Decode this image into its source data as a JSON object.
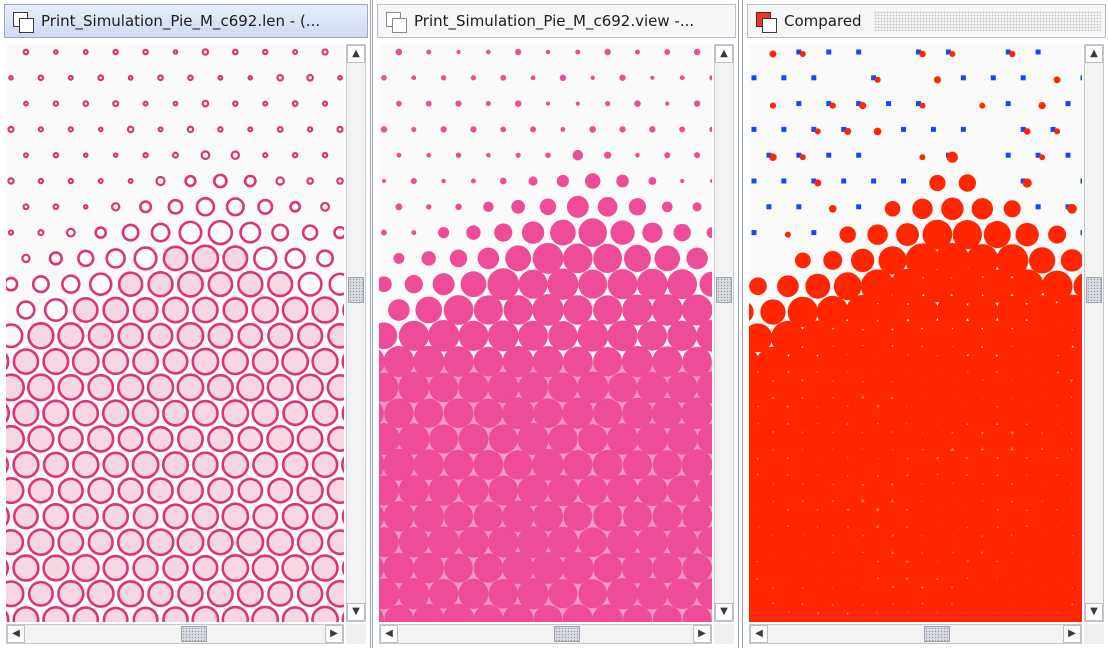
{
  "panes": [
    {
      "title": "Print_Simulation_Pie_M_c692.len - (...",
      "icon": "window-icon",
      "view": "circle-outline-halftone"
    },
    {
      "title": "Print_Simulation_Pie_M_c692.view -...",
      "icon": "window-icon",
      "view": "solid-pink-halftone"
    },
    {
      "title": "Compared",
      "icon": "red-window-icon",
      "view": "difference-halftone"
    }
  ],
  "scrollbar_glyphs": {
    "up": "▲",
    "down": "▼",
    "left": "◀",
    "right": "▶"
  },
  "colors": {
    "magenta_outline": "#d8357a",
    "magenta_fill": "#f7d6e4",
    "pink_solid": "#ee4c96",
    "diff_red": "#ff2600",
    "diff_blue": "#1446ff",
    "title_active": "#cfdaf1"
  }
}
